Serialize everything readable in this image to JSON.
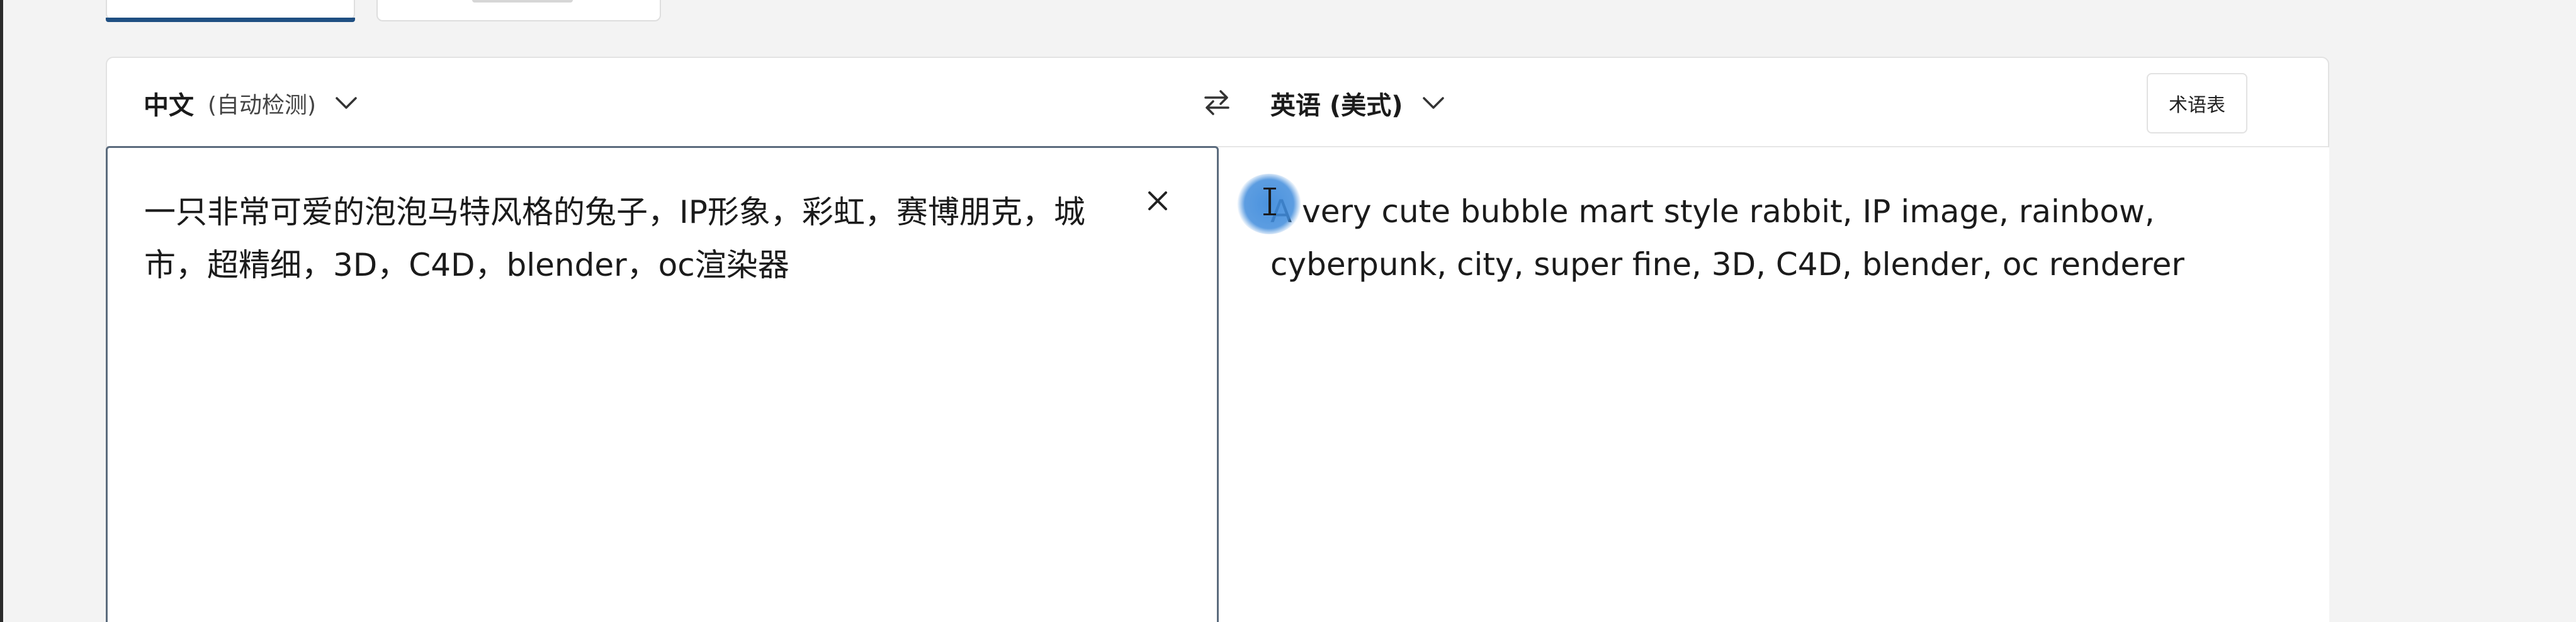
{
  "source": {
    "language_label": "中文",
    "detect_label": "(自动检测)",
    "text": "一只非常可爱的泡泡马特风格的兔子，IP形象，彩虹，赛博朋克，城市，超精细，3D，C4D，blender，oc渲染器"
  },
  "target": {
    "language_label": "英语 (美式)",
    "text": "A very cute bubble mart style rabbit, IP image, rainbow, cyberpunk, city, super fine, 3D, C4D, blender, oc renderer"
  },
  "toolbar": {
    "glossary_label": "术语表"
  },
  "icons": {
    "source_dropdown": "chevron-down-icon",
    "target_dropdown": "chevron-down-icon",
    "swap": "swap-arrows-icon",
    "clear": "close-icon"
  },
  "colors": {
    "active_tab_accent": "#1f4f82",
    "focus_border": "#5b6b7d",
    "cursor_highlight": "#408cdc"
  }
}
